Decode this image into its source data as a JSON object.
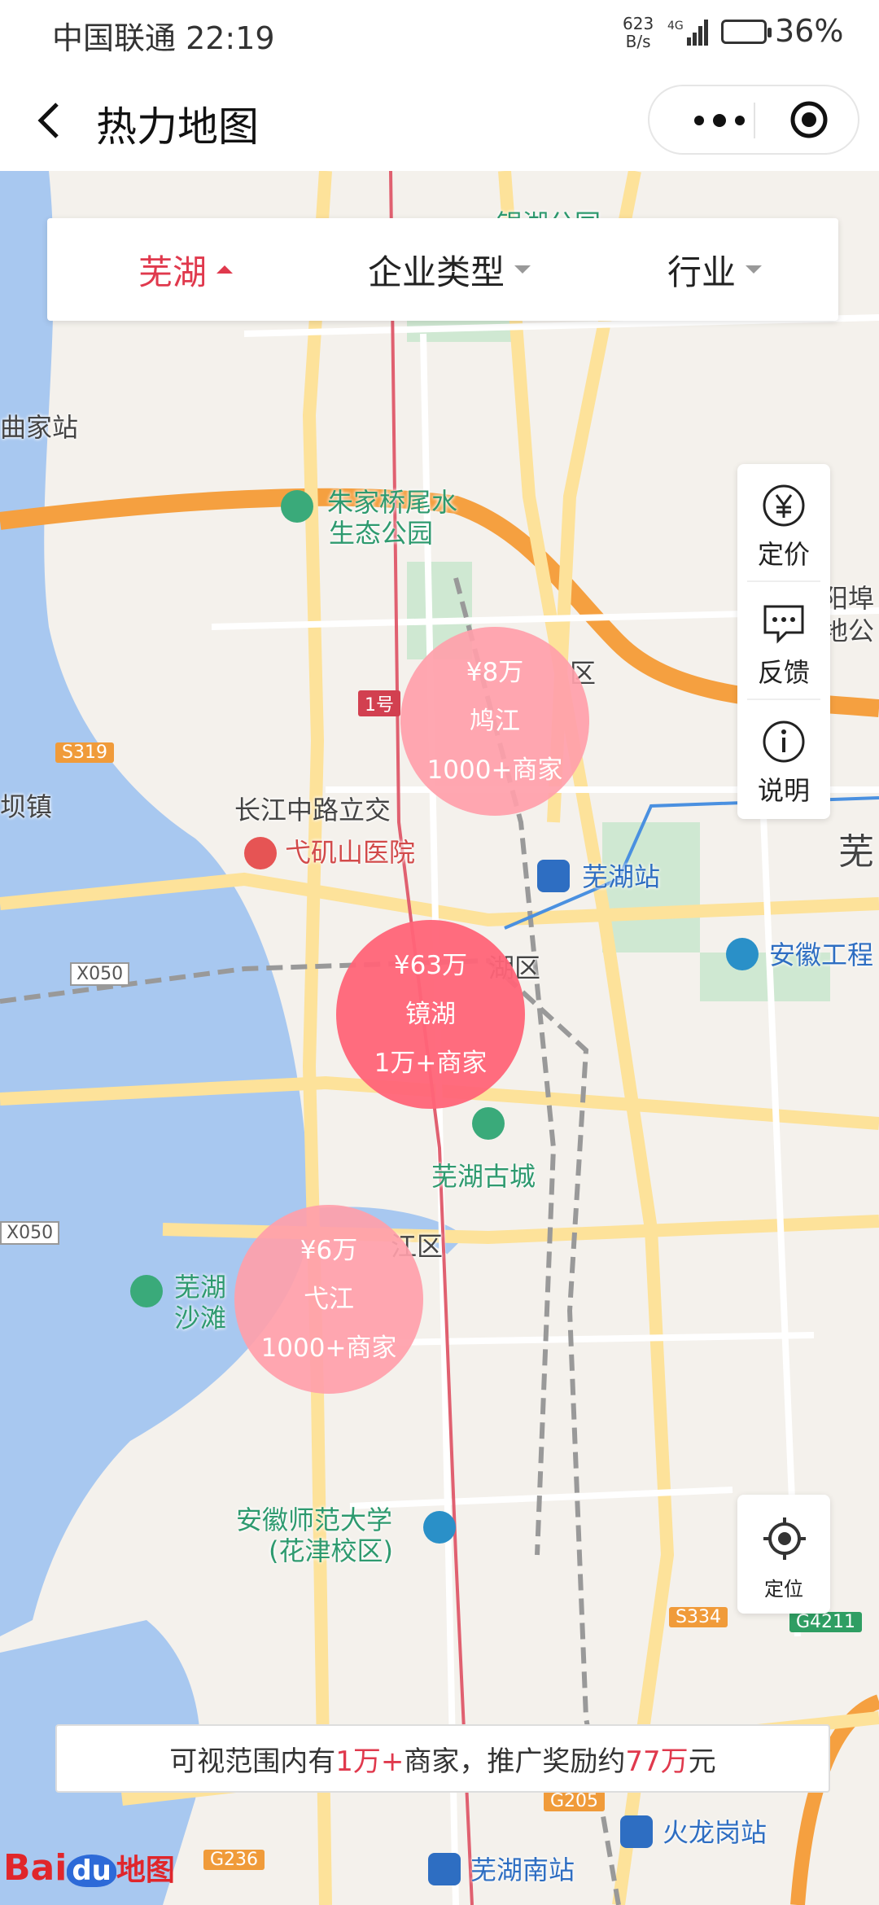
{
  "status_bar": {
    "carrier_time": "中国联通 22:19",
    "net_speed_top": "623",
    "net_speed_bottom": "B/s",
    "battery_pct": "36%"
  },
  "nav": {
    "title": "热力地图",
    "back_icon": "chevron-left-icon",
    "more_icon": "more-dots-icon",
    "close_icon": "target-icon"
  },
  "filters": [
    {
      "label": "芜湖",
      "active": true
    },
    {
      "label": "企业类型",
      "active": false
    },
    {
      "label": "行业",
      "active": false
    }
  ],
  "side_panel": [
    {
      "label": "定价",
      "icon": "yen-icon"
    },
    {
      "label": "反馈",
      "icon": "chat-bubble-icon"
    },
    {
      "label": "说明",
      "icon": "info-icon"
    }
  ],
  "locate_button": {
    "label": "定位",
    "icon": "crosshair-icon"
  },
  "bubbles": [
    {
      "amount": "¥8万",
      "district": "鸠江",
      "merchants": "1000+商家",
      "style": "light"
    },
    {
      "amount": "¥63万",
      "district": "镜湖",
      "merchants": "1万+商家",
      "style": "dark"
    },
    {
      "amount": "¥6万",
      "district": "弋江",
      "merchants": "1000+商家",
      "style": "light"
    }
  ],
  "map_labels": {
    "qujiazhan": "曲家站",
    "yinhu": "银湖公园",
    "zhujiaqiao": "朱家桥尾水",
    "shengtai": "生态公园",
    "changjiang": "长江中路立交",
    "yijishan": "弋矶山医院",
    "wuhuzhan": "芜湖站",
    "anhuigong": "安徽工程",
    "gucheng": "芜湖古城",
    "wuhu_s": "芜湖",
    "shatan": "沙滩",
    "anhuishifan": "安徽师范大学",
    "huajin": "(花津校区)",
    "huolonggang": "火龙岗站",
    "wuhunan": "芜湖南站",
    "qu1": "区",
    "qu2": "湖区",
    "qu3": "江区",
    "zhen": "坝镇",
    "yangbu": "阳埠",
    "digong": "地公",
    "wu": "芜",
    "line1": "1号",
    "s319": "S319",
    "x050a": "X050",
    "x050b": "X050",
    "s334": "S334",
    "g4211": "G4211",
    "g236": "G236",
    "g205": "G205"
  },
  "info_bar": {
    "prefix": "可视范围内有",
    "count": "1万+",
    "middle": "商家，推广奖励约",
    "amount": "77万",
    "suffix": "元"
  },
  "logo": {
    "bai": "Bai",
    "du": "du",
    "tu": "地图"
  }
}
